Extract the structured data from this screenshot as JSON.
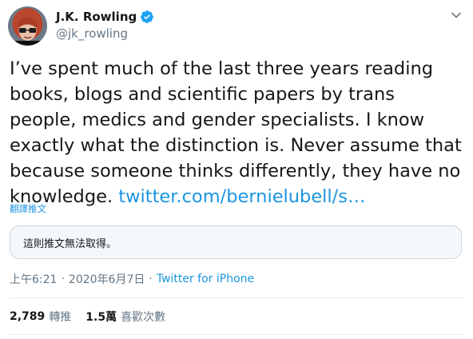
{
  "author": {
    "display_name": "J.K. Rowling",
    "handle": "@jk_rowling",
    "verified_icon": "verified-badge-icon"
  },
  "tweet": {
    "text": "I’ve spent much of the last three years reading books, blogs and scientific papers by trans people, medics and gender specialists. I know exactly what the distinction is. Never assume that because someone thinks differently, they have no knowledge. ",
    "link_text": "twitter.com/bernielubell/s…"
  },
  "translate_label": "翻譯推文",
  "quoted_unavailable": "這則推文無法取得。",
  "meta": {
    "time": "上午6:21",
    "separator1": "·",
    "date": "2020年6月7日",
    "separator2": "·",
    "source": "Twitter for iPhone"
  },
  "stats": {
    "retweets_count": "2,789",
    "retweets_label": "轉推",
    "likes_count": "1.5萬",
    "likes_label": "喜歡次數"
  },
  "colors": {
    "accent": "#1b95e0",
    "text": "#14171a",
    "secondary": "#657786",
    "verified": "#1da1f2"
  },
  "icons": {
    "more": "chevron-down-icon",
    "verified": "verified-badge-icon"
  }
}
